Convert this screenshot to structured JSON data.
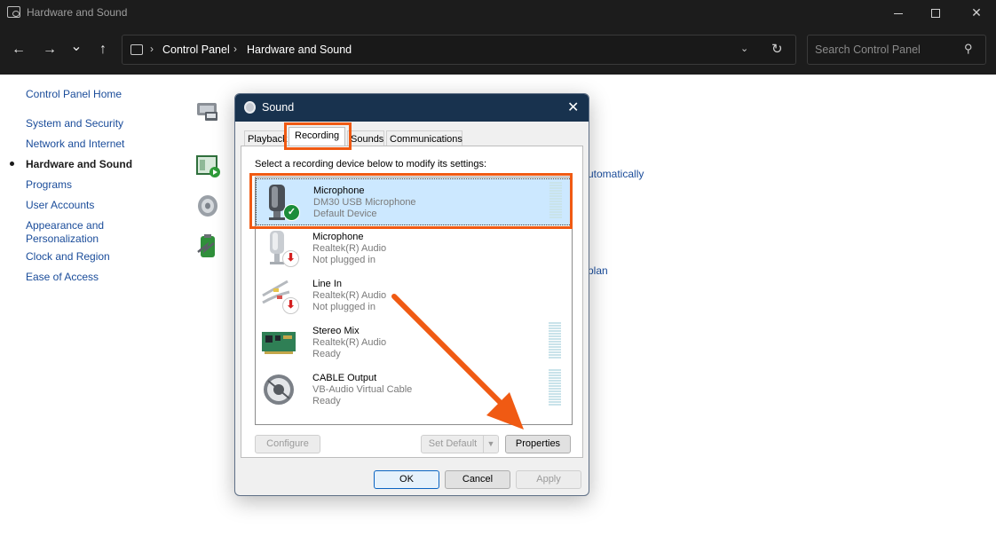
{
  "window": {
    "title": "Hardware and Sound"
  },
  "nav": {
    "back": "←",
    "forward": "→",
    "recent": "⌄",
    "up": "↑",
    "breadcrumb": [
      "Control Panel",
      "Hardware and Sound"
    ],
    "search_placeholder": "Search Control Panel"
  },
  "sidebar": {
    "items": [
      {
        "label": "Control Panel Home"
      },
      {
        "label": "System and Security"
      },
      {
        "label": "Network and Internet"
      },
      {
        "label": "Hardware and Sound",
        "active": true
      },
      {
        "label": "Programs"
      },
      {
        "label": "User Accounts"
      },
      {
        "label": "Appearance and Personalization"
      },
      {
        "label": "Clock and Region"
      },
      {
        "label": "Ease of Access"
      }
    ]
  },
  "main": {
    "partial_links": [
      "utomatically",
      "plan"
    ]
  },
  "dialog": {
    "title": "Sound",
    "tabs": [
      "Playback",
      "Recording",
      "Sounds",
      "Communications"
    ],
    "selected_tab": "Recording",
    "instruction": "Select a recording device below to modify its settings:",
    "devices": [
      {
        "name": "Microphone",
        "desc": "DM30 USB Microphone",
        "status": "Default Device",
        "icon": "microphone-icon",
        "badge": "check",
        "selected": true,
        "level_meter": true
      },
      {
        "name": "Microphone",
        "desc": "Realtek(R) Audio",
        "status": "Not plugged in",
        "icon": "microphone-icon",
        "badge": "down-arrow",
        "selected": false,
        "level_meter": false
      },
      {
        "name": "Line In",
        "desc": "Realtek(R) Audio",
        "status": "Not plugged in",
        "icon": "rca-cable-icon",
        "badge": "down-arrow",
        "selected": false,
        "level_meter": false
      },
      {
        "name": "Stereo Mix",
        "desc": "Realtek(R) Audio",
        "status": "Ready",
        "icon": "sound-card-icon",
        "badge": null,
        "selected": false,
        "level_meter": true
      },
      {
        "name": "CABLE Output",
        "desc": "VB-Audio Virtual Cable",
        "status": "Ready",
        "icon": "cable-output-icon",
        "badge": null,
        "selected": false,
        "level_meter": true
      }
    ],
    "buttons": {
      "configure": "Configure",
      "set_default": "Set Default",
      "properties": "Properties",
      "ok": "OK",
      "cancel": "Cancel",
      "apply": "Apply"
    }
  },
  "annotation": {
    "highlight_color": "#f05a13"
  }
}
